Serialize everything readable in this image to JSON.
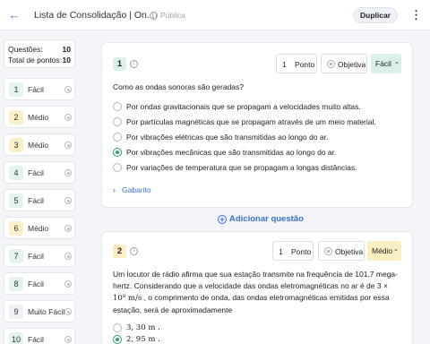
{
  "header": {
    "back_icon": "arrow-left-icon",
    "title": "Lista de Consolidação | On...",
    "visibility_label": "Pública",
    "duplicate_label": "Duplicar",
    "more_icon": "kebab-menu-icon"
  },
  "summary": {
    "questions_label": "Questões:",
    "questions_value": "10",
    "points_label": "Total de pontos:",
    "points_value": "10"
  },
  "question_nav": [
    {
      "number": "1",
      "level": "Fácil",
      "color": "#e3f3ee"
    },
    {
      "number": "2",
      "level": "Médio",
      "color": "#fbf0c9"
    },
    {
      "number": "3",
      "level": "Médio",
      "color": "#fbf0c9"
    },
    {
      "number": "4",
      "level": "Fácil",
      "color": "#e3f3ee"
    },
    {
      "number": "5",
      "level": "Fácil",
      "color": "#e3f3ee"
    },
    {
      "number": "6",
      "level": "Médio",
      "color": "#fbf0c9"
    },
    {
      "number": "7",
      "level": "Fácil",
      "color": "#e3f3ee"
    },
    {
      "number": "8",
      "level": "Fácil",
      "color": "#e3f3ee"
    },
    {
      "number": "9",
      "level": "Muito Fácil",
      "color": "#eef1f5"
    },
    {
      "number": "10",
      "level": "Fácil",
      "color": "#e3f3ee"
    }
  ],
  "q1": {
    "number": "1",
    "points": "1",
    "points_label": "Ponto",
    "type_label": "Objetiva",
    "difficulty": "Fácil",
    "difficulty_color": "#d9f1e8",
    "stem": "Como as ondas sonoras são geradas?",
    "options": [
      "Por ondas gravitacionais que se propagam a velocidades muito altas.",
      "Por partículas magnéticas que se propagam através de um meio material.",
      "Por vibrações elétricas que são transmitidas ao longo do ar.",
      "Por vibrações mecânicas que são transmitidas ao longo do ar.",
      "Por variações de temperatura que se propagam a longas distâncias."
    ],
    "selected_option": 3,
    "answer_key_label": "Gabarito"
  },
  "add_question_label": "Adicionar questão",
  "q2": {
    "number": "2",
    "points": "1",
    "points_label": "Ponto",
    "type_label": "Objetiva",
    "difficulty": "Médio",
    "difficulty_color": "#fbeec0",
    "stem_line1": "Um locutor de rádio afirma que sua estação transmite na frequência de 101,7 mega-",
    "stem_line2": "hertz. Considerando que a velocidade das ondas eletromagnéticas no ar é de  3 ×",
    "stem_line3_math": "10⁸ m/s",
    "stem_line3_text": " , o comprimento de onda, das ondas eletromagnéticas emitidas por essa",
    "stem_line4": "estação, será de aproximadamente",
    "options": [
      "3, 30 m .",
      "2, 95 m ."
    ],
    "selected_option": 1
  }
}
